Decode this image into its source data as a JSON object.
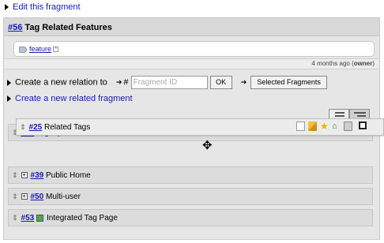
{
  "edit_link": "Edit this fragment",
  "fragment": {
    "id": "#56",
    "title": "Tag Related Features",
    "tag": "feature",
    "meta_age": "4 months ago",
    "meta_owner": "owner"
  },
  "relation": {
    "label": "Create a new relation to",
    "hash_prefix": "#",
    "input_placeholder": "Fragment ID",
    "ok_label": "OK",
    "selected_label": "Selected Fragments"
  },
  "create_related": "Create a new related fragment",
  "items": [
    {
      "id": "#27",
      "title": "Tag Input Assistance"
    },
    {
      "id": "#39",
      "title": "Public Home"
    },
    {
      "id": "#50",
      "title": "Multi-user"
    },
    {
      "id": "#53",
      "title": "Integrated Tag Page"
    }
  ],
  "dragging_item": {
    "id": "#25",
    "title": "Related Tags"
  },
  "icons": {
    "tag": "tag-icon",
    "remove": "remove-tag-icon",
    "expand": "expand-icon",
    "drag": "drag-handle-icon",
    "move_cursor": "move-cursor-icon"
  },
  "colors": {
    "link": "#1a1ab8",
    "panel_bg": "#e6e6e6",
    "header_bg": "#d9d9d9"
  }
}
